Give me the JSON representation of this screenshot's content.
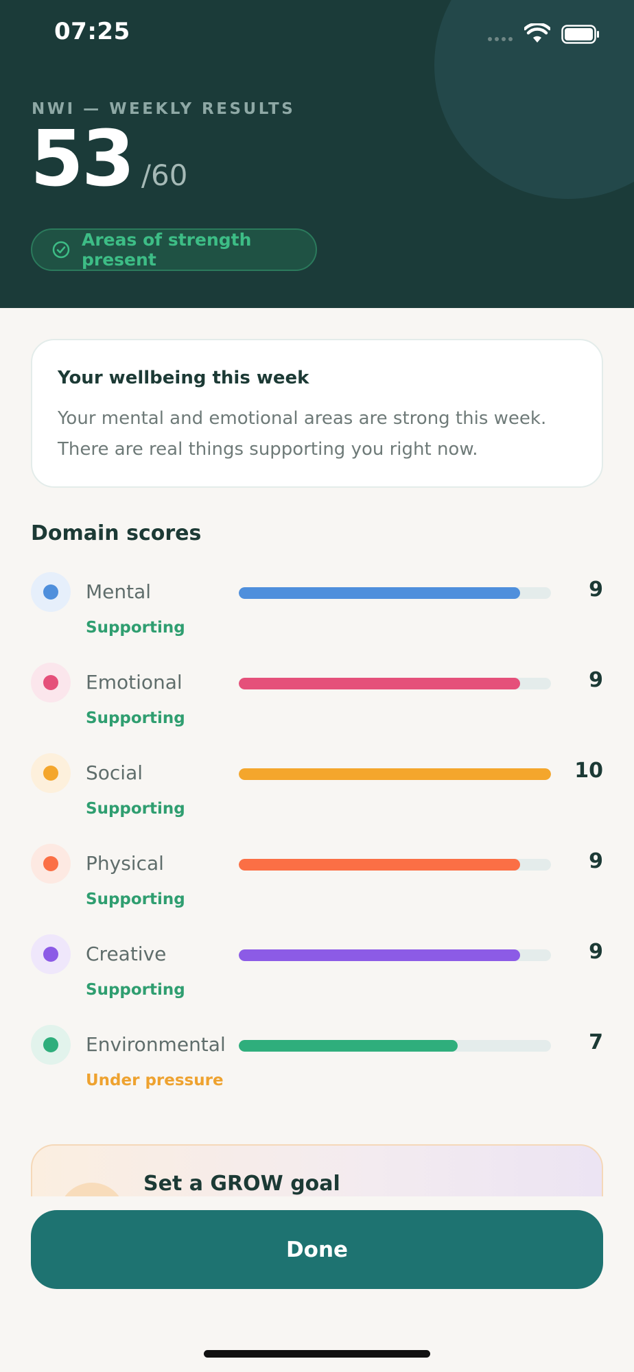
{
  "status_bar": {
    "time": "07:25"
  },
  "header": {
    "eyebrow": "NWI — WEEKLY RESULTS",
    "score": "53",
    "score_max": "/60",
    "badge": "Areas of strength present",
    "badge_color": "#3dbd86"
  },
  "summary": {
    "title": "Your wellbeing this week",
    "body": "Your mental and emotional areas are strong this week. There are real things supporting you right now."
  },
  "domains": {
    "title": "Domain scores",
    "max": 10,
    "items": [
      {
        "name": "Mental",
        "value": 9,
        "status": "Supporting",
        "color": "#4f8fdc",
        "tint": "#e6effb",
        "status_color": "#2f9e70"
      },
      {
        "name": "Emotional",
        "value": 9,
        "status": "Supporting",
        "color": "#e5507a",
        "tint": "#fbe6ec",
        "status_color": "#2f9e70"
      },
      {
        "name": "Social",
        "value": 10,
        "status": "Supporting",
        "color": "#f4a62c",
        "tint": "#fdf0dc",
        "status_color": "#2f9e70"
      },
      {
        "name": "Physical",
        "value": 9,
        "status": "Supporting",
        "color": "#fb6f45",
        "tint": "#fde9e2",
        "status_color": "#2f9e70"
      },
      {
        "name": "Creative",
        "value": 9,
        "status": "Supporting",
        "color": "#8c5be6",
        "tint": "#efe7fb",
        "status_color": "#2f9e70"
      },
      {
        "name": "Environmental",
        "value": 7,
        "status": "Under pressure",
        "color": "#2fae7c",
        "tint": "#e2f3ec",
        "status_color": "#eea22f"
      }
    ]
  },
  "grow": {
    "title": "Set a GROW goal"
  },
  "done_label": "Done"
}
